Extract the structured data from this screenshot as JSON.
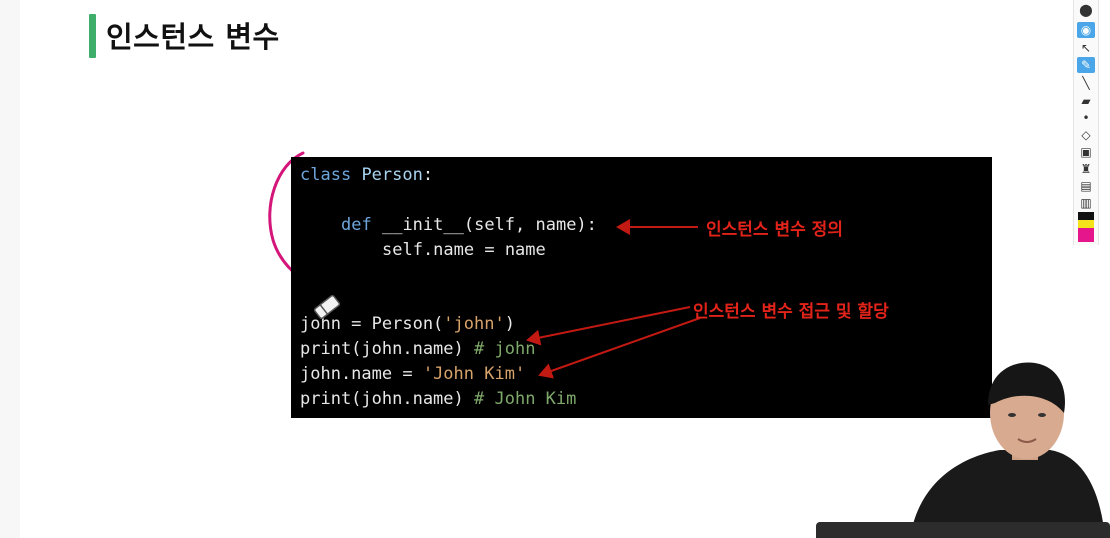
{
  "slide": {
    "title": "인스턴스 변수",
    "accent_color": "#3fae6a"
  },
  "code": {
    "line1": {
      "kw": "class",
      "name": "Person",
      "end": ":"
    },
    "line3": {
      "kw": "def",
      "rest": "__init__(self, name):"
    },
    "line4": {
      "text": "self.name = name"
    },
    "line6": {
      "pre": "john = Person(",
      "str": "'john'",
      "post": ")"
    },
    "line7": {
      "code": "print(john.name)",
      "comment": "# john"
    },
    "line8": {
      "pre": "john.name = ",
      "str": "'John Kim'"
    },
    "line9": {
      "code": "print(john.name)",
      "comment": "# John Kim"
    }
  },
  "annotations": {
    "define": "인스턴스 변수 정의",
    "access": "인스턴스 변수 접근 및 할당",
    "color": "#e2231a"
  },
  "toolbar": {
    "icons": [
      "logo-icon",
      "eye-icon",
      "cursor-icon",
      "pen-icon",
      "line-icon",
      "highlighter-icon",
      "dot-icon",
      "eraser-icon",
      "trash-icon",
      "stamp-icon",
      "screenshot-icon",
      "clipboard-icon",
      "color-palette-icon"
    ]
  }
}
